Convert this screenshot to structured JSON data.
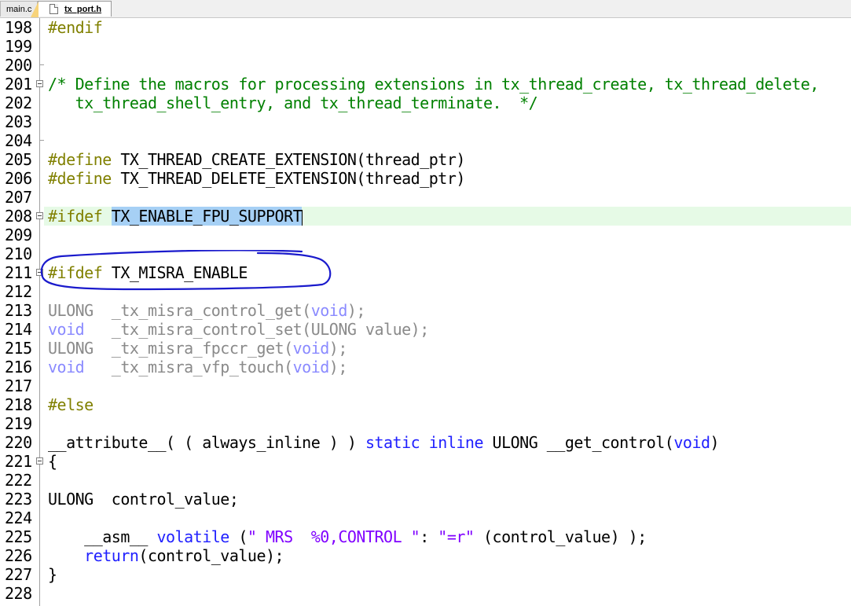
{
  "tabs": [
    {
      "label": "main.c"
    },
    {
      "label": "tx_port.h"
    }
  ],
  "lines": [
    {
      "n": "198"
    },
    {
      "n": "199"
    },
    {
      "n": "200"
    },
    {
      "n": "201"
    },
    {
      "n": "202"
    },
    {
      "n": "203"
    },
    {
      "n": "204"
    },
    {
      "n": "205"
    },
    {
      "n": "206"
    },
    {
      "n": "207"
    },
    {
      "n": "208"
    },
    {
      "n": "209"
    },
    {
      "n": "210"
    },
    {
      "n": "211"
    },
    {
      "n": "212"
    },
    {
      "n": "213"
    },
    {
      "n": "214"
    },
    {
      "n": "215"
    },
    {
      "n": "216"
    },
    {
      "n": "217"
    },
    {
      "n": "218"
    },
    {
      "n": "219"
    },
    {
      "n": "220"
    },
    {
      "n": "221"
    },
    {
      "n": "222"
    },
    {
      "n": "223"
    },
    {
      "n": "224"
    },
    {
      "n": "225"
    },
    {
      "n": "226"
    },
    {
      "n": "227"
    },
    {
      "n": "228"
    }
  ],
  "code": {
    "l198": "#endif",
    "l201": "/* Define the macros for processing extensions in tx_thread_create, tx_thread_delete,",
    "l202": "   tx_thread_shell_entry, and tx_thread_terminate.  */",
    "l205_kw": "#define",
    "l205_rest": " TX_THREAD_CREATE_EXTENSION(thread_ptr)",
    "l206_kw": "#define",
    "l206_rest": " TX_THREAD_DELETE_EXTENSION(thread_ptr)",
    "l208_kw": "#ifdef",
    "l208_sel": "TX_ENABLE_FPU_SUPPORT",
    "l211_kw": "#ifdef",
    "l211_rest": " TX_MISRA_ENABLE",
    "l213_type": "ULONG",
    "l213_a": "  _tx_misra_control_get(",
    "l213_void": "void",
    "l213_b": ");",
    "l214_type": "void",
    "l214_a": "   _tx_misra_control_set(ULONG value);",
    "l215_type": "ULONG",
    "l215_a": "  _tx_misra_fpccr_get(",
    "l215_void": "void",
    "l215_b": ");",
    "l216_type": "void",
    "l216_a": "   _tx_misra_vfp_touch(",
    "l216_void": "void",
    "l216_b": ");",
    "l218": "#else",
    "l220_a": "__attribute__( ( always_inline ) ) ",
    "l220_static": "static",
    "l220_sp": " ",
    "l220_inline": "inline",
    "l220_b": " ULONG __get_control(",
    "l220_void": "void",
    "l220_c": ")",
    "l221": "{",
    "l223": "ULONG  control_value;",
    "l225_a": "    __asm__ ",
    "l225_vol": "volatile",
    "l225_b": " (",
    "l225_s1": "\" MRS  %0,CONTROL \"",
    "l225_c": ": ",
    "l225_s2": "\"=r\"",
    "l225_d": " (control_value) );",
    "l226_sp": "    ",
    "l226_ret": "return",
    "l226_b": "(control_value);",
    "l227": "}"
  },
  "colors": {
    "comment": "#008000",
    "preprocessor": "#808000",
    "keyword": "#1f1fff",
    "string": "#8000ff",
    "line_highlight": "#e6fae6",
    "selection": "#a6d0f5",
    "annotation": "#1a1acc"
  },
  "icons": {
    "file_tab_icon": "file-icon",
    "fold_markers": "fold-minus-icon",
    "annotation": "hand-drawn-circle"
  }
}
